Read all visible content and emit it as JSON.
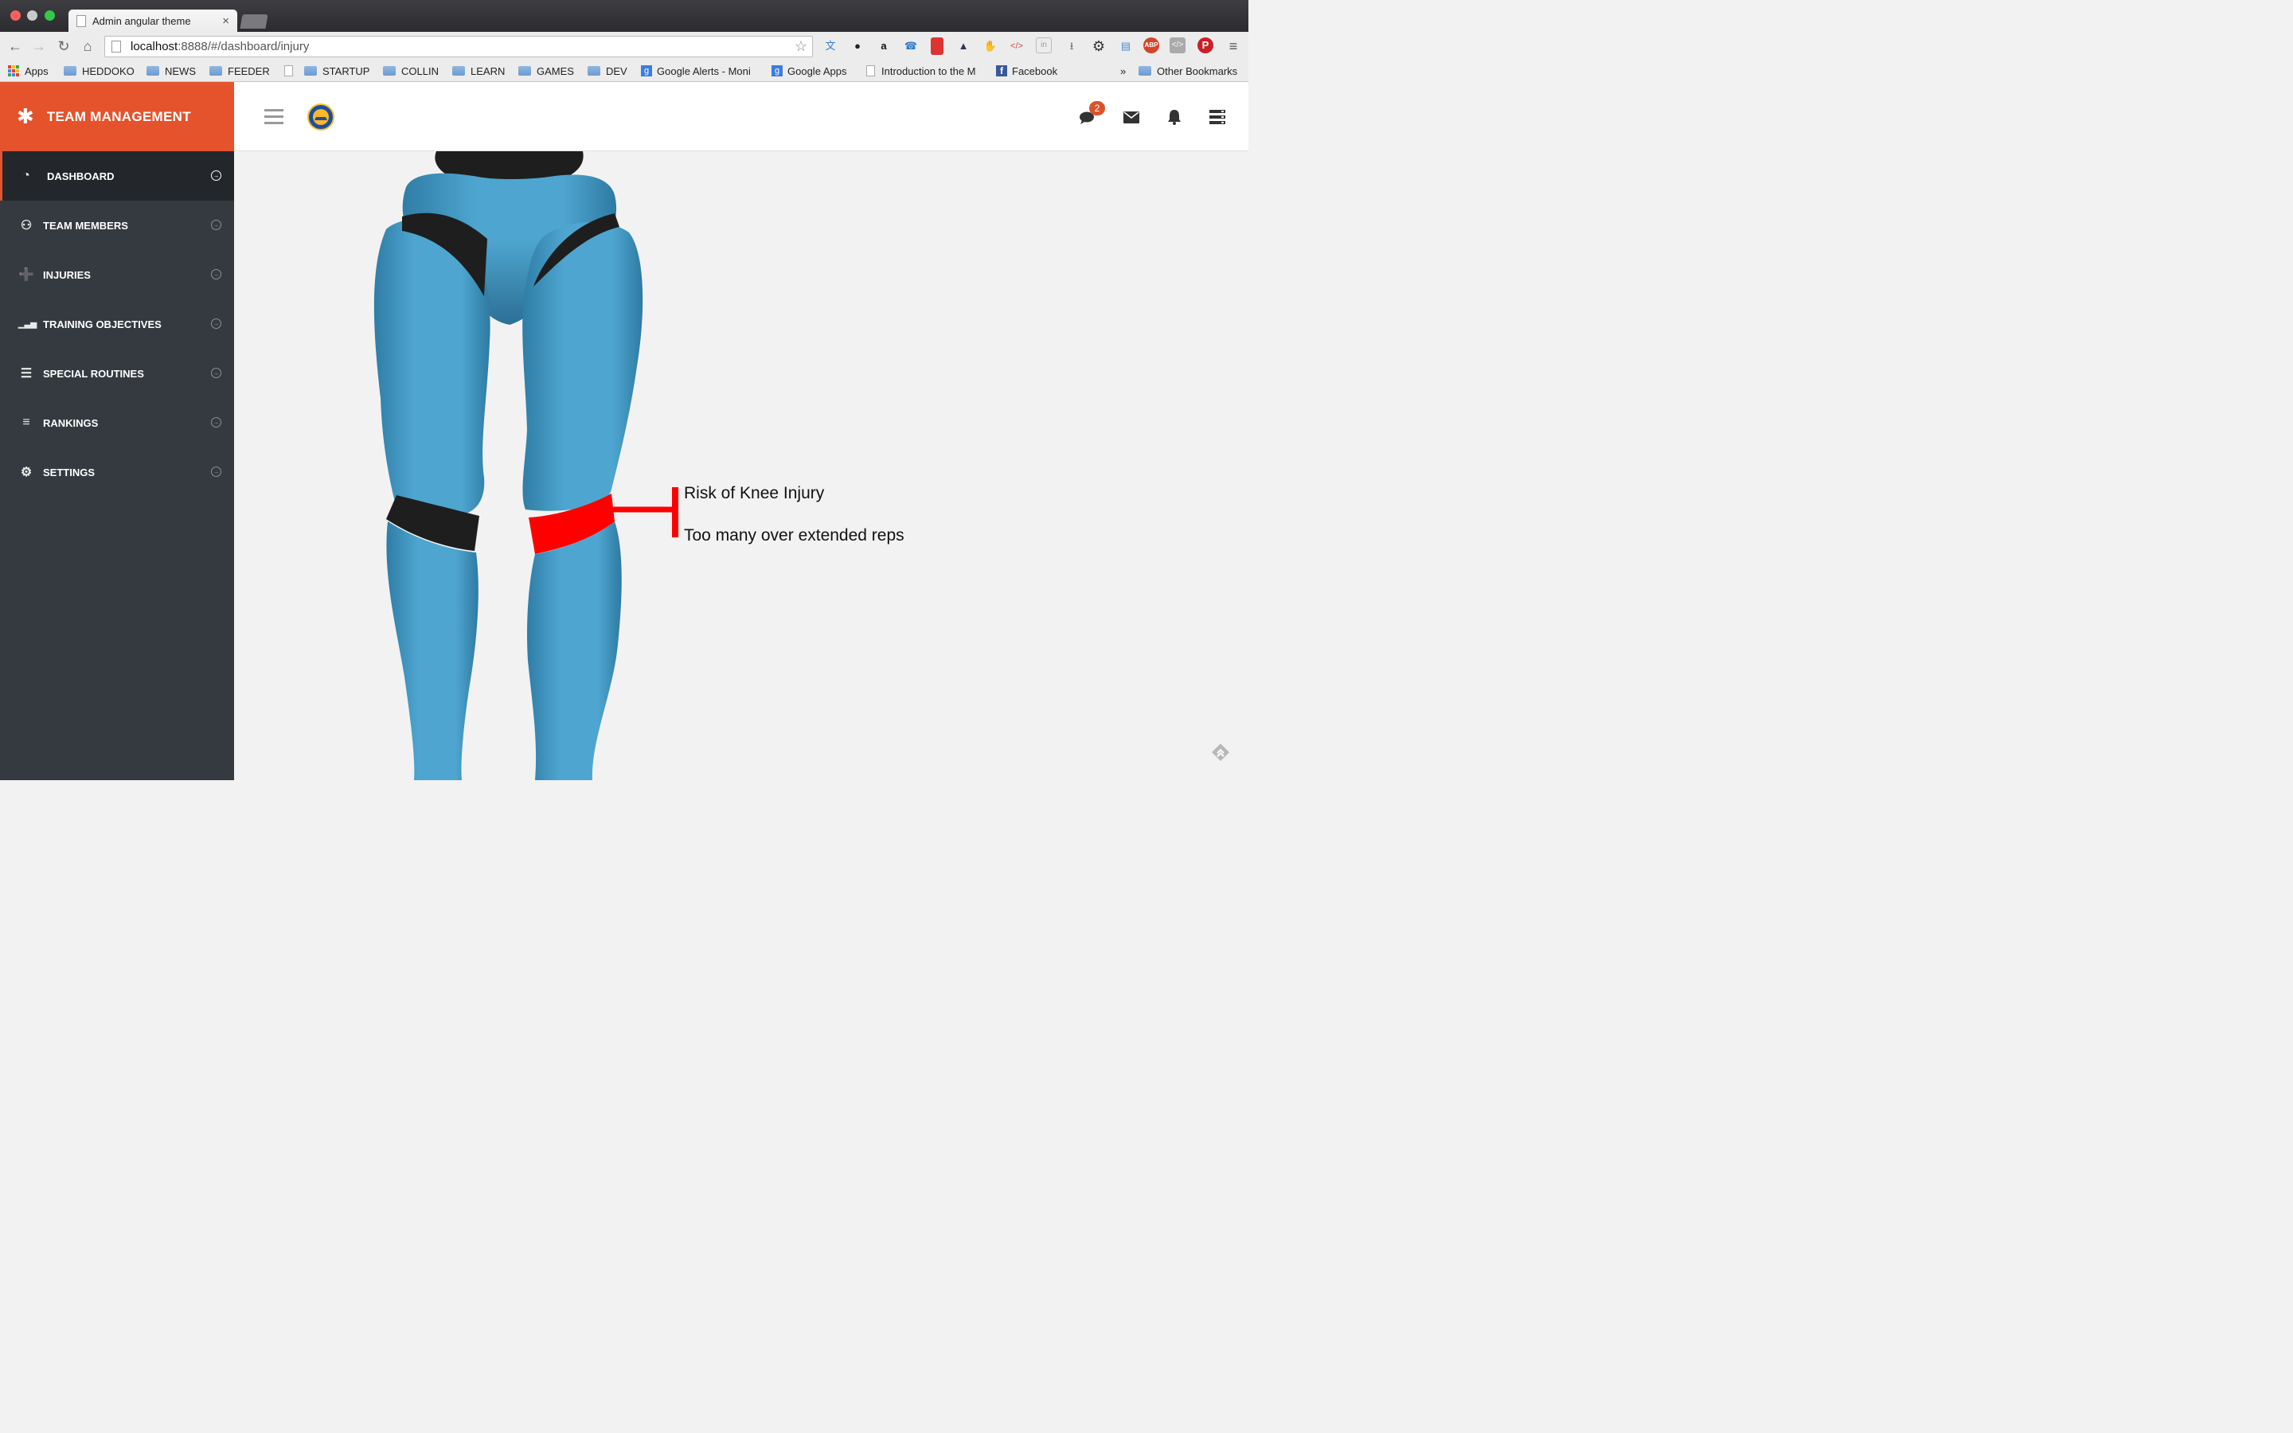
{
  "browser": {
    "tab_title": "Admin angular theme",
    "tab_close": "×",
    "url_host": "localhost",
    "url_path": ":8888/#/dashboard/injury",
    "bookmarks": [
      {
        "label": "Apps",
        "kind": "apps"
      },
      {
        "label": "HEDDOKO",
        "kind": "folder"
      },
      {
        "label": "NEWS",
        "kind": "folder"
      },
      {
        "label": "FEEDER",
        "kind": "folder"
      },
      {
        "label": "",
        "kind": "page"
      },
      {
        "label": "STARTUP",
        "kind": "folder"
      },
      {
        "label": "COLLIN",
        "kind": "folder"
      },
      {
        "label": "LEARN",
        "kind": "folder"
      },
      {
        "label": "GAMES",
        "kind": "folder"
      },
      {
        "label": "DEV",
        "kind": "folder"
      },
      {
        "label": "Google Alerts - Moni",
        "kind": "google"
      },
      {
        "label": "Google Apps",
        "kind": "google"
      },
      {
        "label": "Introduction to the M",
        "kind": "page"
      },
      {
        "label": "Facebook",
        "kind": "facebook"
      },
      {
        "label": "Other Bookmarks",
        "kind": "folder"
      }
    ],
    "overflow": "»"
  },
  "app": {
    "brand_title": "TEAM MANAGEMENT",
    "nav": [
      {
        "label": "DASHBOARD",
        "icon": "dashboard-icon",
        "active": true
      },
      {
        "label": "TEAM MEMBERS",
        "icon": "team-icon",
        "active": false
      },
      {
        "label": "INJURIES",
        "icon": "medkit-icon",
        "active": false
      },
      {
        "label": "TRAINING OBJECTIVES",
        "icon": "bar-chart-icon",
        "active": false
      },
      {
        "label": "SPECIAL ROUTINES",
        "icon": "list-alt-icon",
        "active": false
      },
      {
        "label": "RANKINGS",
        "icon": "list-icon",
        "active": false
      },
      {
        "label": "SETTINGS",
        "icon": "gear-icon",
        "active": false
      }
    ],
    "chat_badge": "2",
    "injury": {
      "title": "Risk of Knee Injury",
      "detail": "Too many over extended reps"
    },
    "colors": {
      "brand": "#e4532c",
      "sidebar": "#353a40",
      "leg": "#4ea6d0",
      "highlight": "#ff0000",
      "badge": "#d9542c"
    }
  }
}
